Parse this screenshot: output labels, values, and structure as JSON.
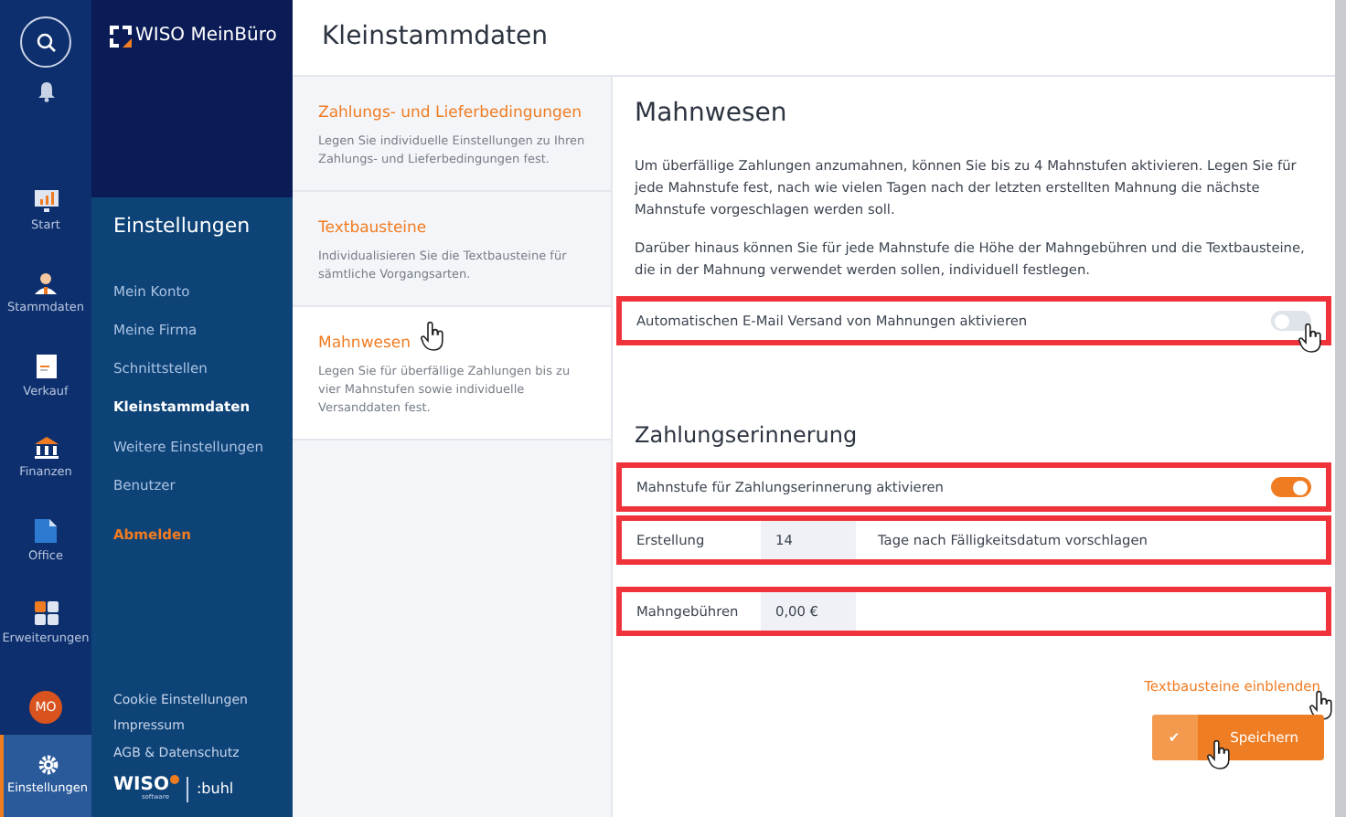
{
  "rail": {
    "items": [
      {
        "label": "Start",
        "selected": false
      },
      {
        "label": "Stammdaten",
        "selected": false
      },
      {
        "label": "Verkauf",
        "selected": false
      },
      {
        "label": "Finanzen",
        "selected": false
      },
      {
        "label": "Office",
        "selected": false
      },
      {
        "label": "Erweiterungen",
        "selected": false
      }
    ],
    "avatar": "MO",
    "settings": {
      "label": "Einstellungen",
      "selected": true
    }
  },
  "brand": "WISO MeinBüro",
  "sidebar": {
    "title": "Einstellungen",
    "items": [
      {
        "label": "Mein Konto",
        "selected": false,
        "kind": "link"
      },
      {
        "label": "Meine Firma",
        "selected": false,
        "kind": "link"
      },
      {
        "label": "Schnittstellen",
        "selected": false,
        "kind": "link"
      },
      {
        "label": "Kleinstammdaten",
        "selected": true,
        "kind": "link"
      },
      {
        "label": "Weitere Einstellungen",
        "selected": false,
        "kind": "link"
      },
      {
        "label": "Benutzer",
        "selected": false,
        "kind": "link"
      },
      {
        "label": "Abmelden",
        "kind": "logout"
      }
    ],
    "footer_links": [
      "Cookie Einstellungen",
      "Impressum",
      "AGB & Datenschutz"
    ],
    "footer_logo": "WISO",
    "footer_logo_sub": "software",
    "footer_partner": ":buhl"
  },
  "page_title": "Kleinstammdaten",
  "sections": [
    {
      "title": "Zahlungs- und Lieferbedingungen",
      "description": "Legen Sie individuelle Einstellungen zu Ihren Zahlungs- und Lieferbedingungen fest.",
      "selected": false
    },
    {
      "title": "Textbausteine",
      "description": "Individualisieren Sie die Textbausteine für sämtliche Vorgangsarten.",
      "selected": false
    },
    {
      "title": "Mahnwesen",
      "description": "Legen Sie für überfällige Zahlungen bis zu vier Mahnstufen sowie individuelle Versanddaten fest.",
      "selected": true
    }
  ],
  "detail": {
    "title": "Mahnwesen",
    "paragraphs": [
      "Um überfällige Zahlungen anzumahnen, können Sie bis zu 4 Mahnstufen aktivieren. Legen Sie für jede Mahnstufe fest, nach wie vielen Tagen nach der letzten erstellten Mahnung die nächste Mahnstufe vorgeschlagen werden soll.",
      "Darüber hinaus können Sie für jede Mahnstufe die Höhe der Mahngebühren und die Textbausteine, die in der Mahnung verwendet werden sollen, individuell festlegen."
    ],
    "email_toggle": {
      "label": "Automatischen E-Mail Versand von Mahnungen aktivieren",
      "on": false,
      "highlighted": true
    },
    "reminder_title": "Zahlungserinnerung",
    "reminder_rows": [
      {
        "kind": "toggle",
        "label": "Mahnstufe für Zahlungserinnerung aktivieren",
        "on": true,
        "highlighted": true
      },
      {
        "kind": "field",
        "label": "Erstellung",
        "value": "14",
        "suffix": "Tage nach Fälligkeitsdatum vorschlagen",
        "highlighted": true
      },
      {
        "kind": "field",
        "label": "Mahngebühren",
        "value": "0,00 €",
        "highlighted": true
      }
    ],
    "link": "Textbausteine einblenden",
    "save_icon": "✔",
    "save_button": "Speichern"
  }
}
